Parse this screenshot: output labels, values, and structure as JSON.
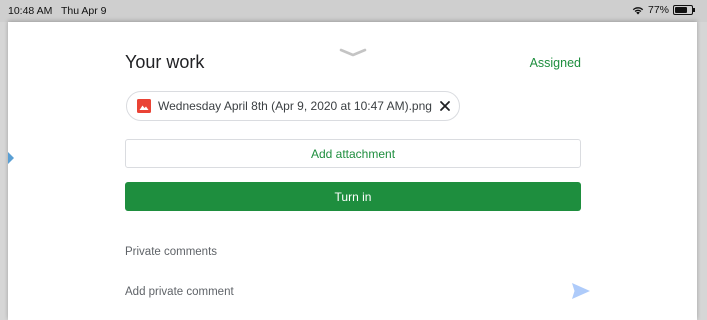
{
  "status_bar": {
    "time": "10:48 AM",
    "date": "Thu Apr 9",
    "battery_percent": "77%",
    "battery_level": 0.77,
    "wifi_icon": "wifi-icon",
    "battery_icon": "battery-icon"
  },
  "sheet": {
    "handle_icon": "chevron-down-icon",
    "title": "Your work",
    "status": "Assigned"
  },
  "attachment": {
    "file_name": "Wednesday April 8th (Apr 9, 2020 at 10:47 AM).png",
    "file_icon": "image-file-icon",
    "remove_icon": "close-icon"
  },
  "buttons": {
    "add_attachment": "Add attachment",
    "turn_in": "Turn in"
  },
  "comments": {
    "section_title": "Private comments",
    "placeholder": "Add private comment",
    "send_icon": "send-icon"
  },
  "colors": {
    "accent_green": "#1e8e3e",
    "file_icon_red": "#ea4335",
    "send_icon_blue": "#aecbfa"
  }
}
